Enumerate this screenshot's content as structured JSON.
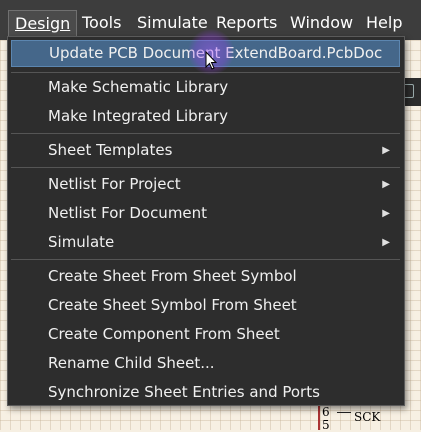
{
  "menubar": {
    "items": [
      {
        "label": "Design",
        "active": true
      },
      {
        "label": "Tools"
      },
      {
        "label": "Simulate"
      },
      {
        "label": "Reports"
      },
      {
        "label": "Window"
      },
      {
        "label": "Help"
      }
    ]
  },
  "design_menu": {
    "update_pcb": "Update PCB Document ExtendBoard.PcbDoc",
    "make_schematic_library": "Make Schematic Library",
    "make_integrated_library": "Make Integrated Library",
    "sheet_templates": "Sheet Templates",
    "netlist_for_project": "Netlist For Project",
    "netlist_for_document": "Netlist For Document",
    "simulate": "Simulate",
    "create_sheet_from_symbol": "Create Sheet From Sheet Symbol",
    "create_symbol_from_sheet": "Create Sheet Symbol From Sheet",
    "create_component_from_sheet": "Create Component From Sheet",
    "rename_child_sheet": "Rename Child Sheet...",
    "synchronize_sheet_entries": "Synchronize Sheet Entries and Ports"
  },
  "schematic": {
    "pin_6": "6",
    "pin_5": "5",
    "net_label": "SCK"
  },
  "colors": {
    "menubar_bg": "#3d3d3d",
    "menu_bg": "#2d2d2d",
    "highlight": "#45678a",
    "text": "#f0f0f0"
  }
}
